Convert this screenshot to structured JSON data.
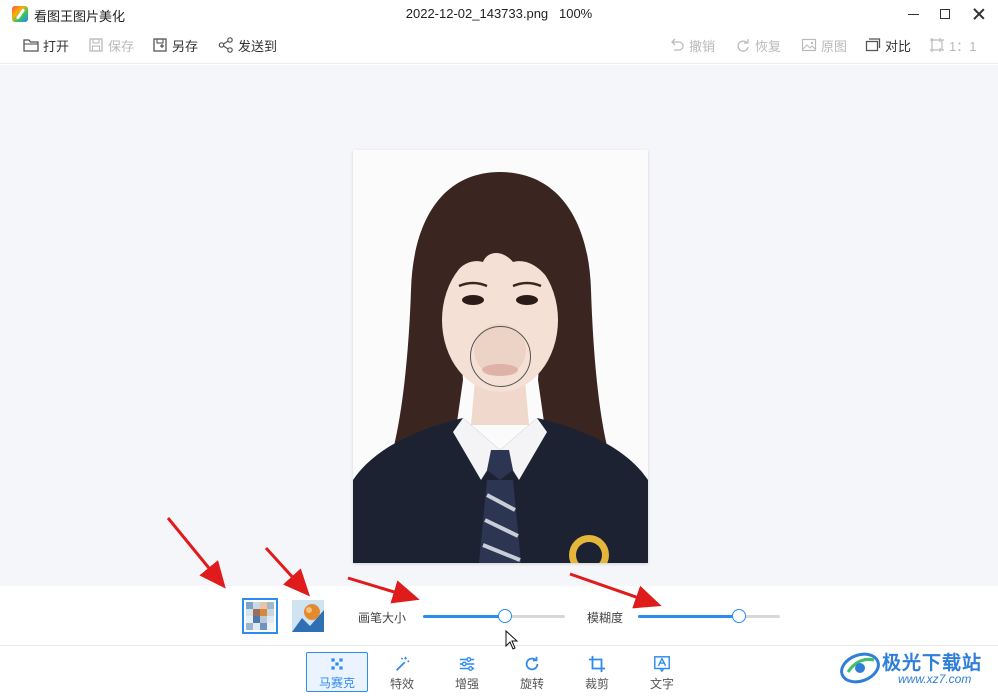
{
  "app": {
    "name": "看图王图片美化",
    "file_title": "2022-12-02_143733.png   100%"
  },
  "toolbar": {
    "open": "打开",
    "save": "保存",
    "save_as": "另存",
    "send_to": "发送到",
    "undo": "撤销",
    "redo": "恢复",
    "original": "原图",
    "compare": "对比",
    "ratio": "1：1"
  },
  "options": {
    "brush_size_label": "画笔大小",
    "brush_size_value": 0.58,
    "blur_label": "模糊度",
    "blur_value": 0.71
  },
  "tools": [
    {
      "label": "马赛克",
      "active": true
    },
    {
      "label": "特效",
      "active": false
    },
    {
      "label": "增强",
      "active": false
    },
    {
      "label": "旋转",
      "active": false
    },
    {
      "label": "裁剪",
      "active": false
    },
    {
      "label": "文字",
      "active": false
    }
  ],
  "watermark": {
    "name": "极光下载站",
    "url": "www.xz7.com"
  },
  "colors": {
    "accent": "#2d8cf0",
    "canvas_bg": "#f5f6f9",
    "arrow": "#e01b1b"
  },
  "icons": [
    "app-logo-icon",
    "folder-open-icon",
    "save-icon",
    "save-as-icon",
    "share-icon",
    "undo-icon",
    "redo-icon",
    "image-icon",
    "compare-icon",
    "ratio-icon",
    "mosaic-icon",
    "magic-wand-icon",
    "sliders-icon",
    "rotate-icon",
    "crop-icon",
    "text-icon"
  ]
}
